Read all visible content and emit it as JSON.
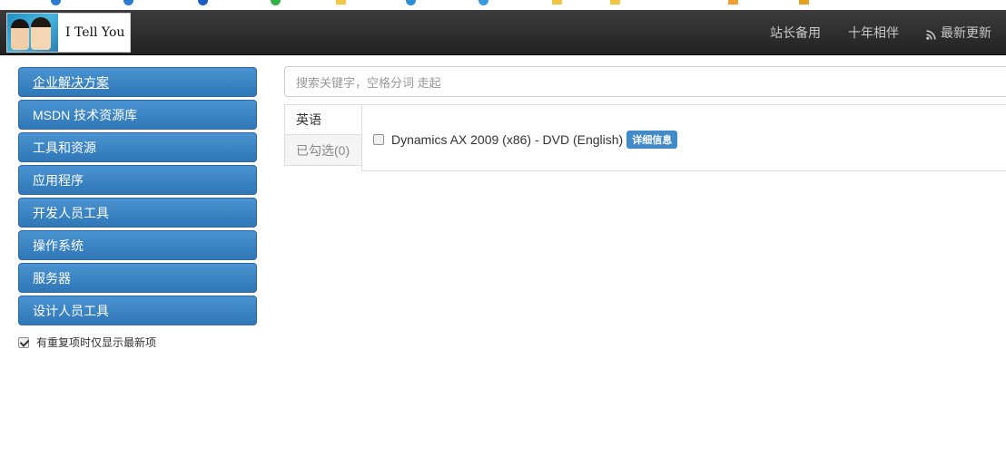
{
  "navbar": {
    "brand_text": "I Tell You",
    "links": [
      "站长备用",
      "十年相伴",
      "最新更新"
    ]
  },
  "sidebar": {
    "items": [
      {
        "label": "企业解决方案",
        "active": true
      },
      {
        "label": "MSDN 技术资源库"
      },
      {
        "label": "工具和资源"
      },
      {
        "label": "应用程序"
      },
      {
        "label": "开发人员工具"
      },
      {
        "label": "操作系统"
      },
      {
        "label": "服务器"
      },
      {
        "label": "设计人员工具"
      }
    ],
    "option_label": "有重复项时仅显示最新项"
  },
  "search": {
    "placeholder": "搜索关键字，空格分词 走起"
  },
  "tabs": [
    {
      "label": "英语"
    },
    {
      "label": "已勾选(0)"
    }
  ],
  "results": [
    {
      "title": "Dynamics AX 2009 (x86) - DVD (English)",
      "badge": "详细信息"
    }
  ],
  "colors": {
    "accent": "#428bca",
    "navbar": "#222222",
    "sidebar_button": "#3a84c4"
  }
}
